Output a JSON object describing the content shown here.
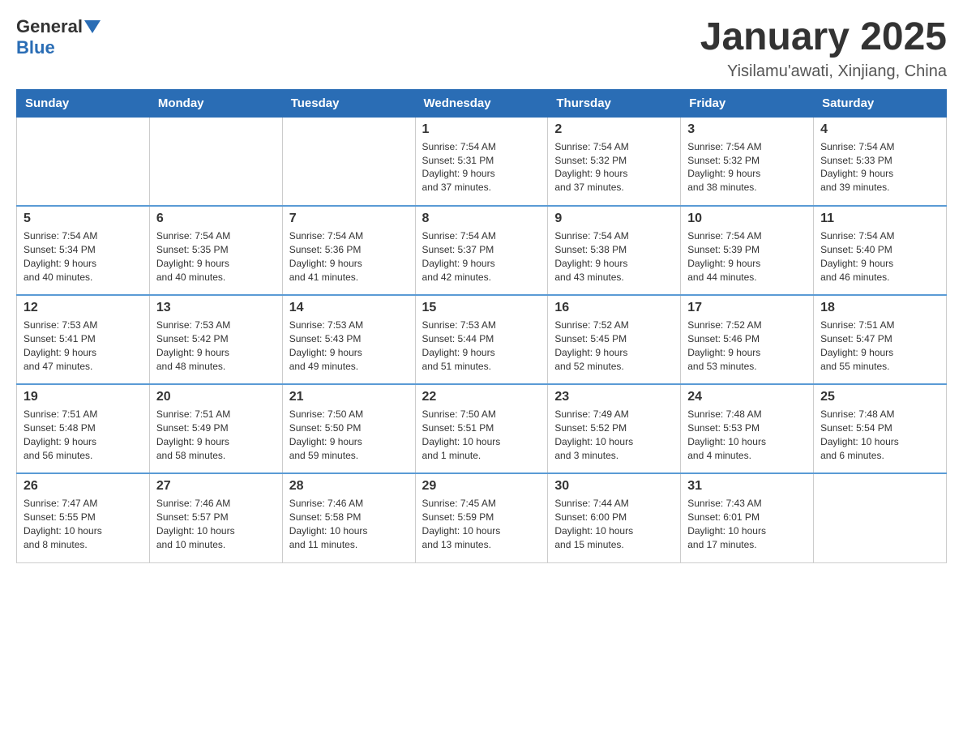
{
  "header": {
    "logo_general": "General",
    "logo_blue": "Blue",
    "month_title": "January 2025",
    "location": "Yisilamu'awati, Xinjiang, China"
  },
  "days_of_week": [
    "Sunday",
    "Monday",
    "Tuesday",
    "Wednesday",
    "Thursday",
    "Friday",
    "Saturday"
  ],
  "weeks": [
    [
      {
        "day": "",
        "info": ""
      },
      {
        "day": "",
        "info": ""
      },
      {
        "day": "",
        "info": ""
      },
      {
        "day": "1",
        "info": "Sunrise: 7:54 AM\nSunset: 5:31 PM\nDaylight: 9 hours\nand 37 minutes."
      },
      {
        "day": "2",
        "info": "Sunrise: 7:54 AM\nSunset: 5:32 PM\nDaylight: 9 hours\nand 37 minutes."
      },
      {
        "day": "3",
        "info": "Sunrise: 7:54 AM\nSunset: 5:32 PM\nDaylight: 9 hours\nand 38 minutes."
      },
      {
        "day": "4",
        "info": "Sunrise: 7:54 AM\nSunset: 5:33 PM\nDaylight: 9 hours\nand 39 minutes."
      }
    ],
    [
      {
        "day": "5",
        "info": "Sunrise: 7:54 AM\nSunset: 5:34 PM\nDaylight: 9 hours\nand 40 minutes."
      },
      {
        "day": "6",
        "info": "Sunrise: 7:54 AM\nSunset: 5:35 PM\nDaylight: 9 hours\nand 40 minutes."
      },
      {
        "day": "7",
        "info": "Sunrise: 7:54 AM\nSunset: 5:36 PM\nDaylight: 9 hours\nand 41 minutes."
      },
      {
        "day": "8",
        "info": "Sunrise: 7:54 AM\nSunset: 5:37 PM\nDaylight: 9 hours\nand 42 minutes."
      },
      {
        "day": "9",
        "info": "Sunrise: 7:54 AM\nSunset: 5:38 PM\nDaylight: 9 hours\nand 43 minutes."
      },
      {
        "day": "10",
        "info": "Sunrise: 7:54 AM\nSunset: 5:39 PM\nDaylight: 9 hours\nand 44 minutes."
      },
      {
        "day": "11",
        "info": "Sunrise: 7:54 AM\nSunset: 5:40 PM\nDaylight: 9 hours\nand 46 minutes."
      }
    ],
    [
      {
        "day": "12",
        "info": "Sunrise: 7:53 AM\nSunset: 5:41 PM\nDaylight: 9 hours\nand 47 minutes."
      },
      {
        "day": "13",
        "info": "Sunrise: 7:53 AM\nSunset: 5:42 PM\nDaylight: 9 hours\nand 48 minutes."
      },
      {
        "day": "14",
        "info": "Sunrise: 7:53 AM\nSunset: 5:43 PM\nDaylight: 9 hours\nand 49 minutes."
      },
      {
        "day": "15",
        "info": "Sunrise: 7:53 AM\nSunset: 5:44 PM\nDaylight: 9 hours\nand 51 minutes."
      },
      {
        "day": "16",
        "info": "Sunrise: 7:52 AM\nSunset: 5:45 PM\nDaylight: 9 hours\nand 52 minutes."
      },
      {
        "day": "17",
        "info": "Sunrise: 7:52 AM\nSunset: 5:46 PM\nDaylight: 9 hours\nand 53 minutes."
      },
      {
        "day": "18",
        "info": "Sunrise: 7:51 AM\nSunset: 5:47 PM\nDaylight: 9 hours\nand 55 minutes."
      }
    ],
    [
      {
        "day": "19",
        "info": "Sunrise: 7:51 AM\nSunset: 5:48 PM\nDaylight: 9 hours\nand 56 minutes."
      },
      {
        "day": "20",
        "info": "Sunrise: 7:51 AM\nSunset: 5:49 PM\nDaylight: 9 hours\nand 58 minutes."
      },
      {
        "day": "21",
        "info": "Sunrise: 7:50 AM\nSunset: 5:50 PM\nDaylight: 9 hours\nand 59 minutes."
      },
      {
        "day": "22",
        "info": "Sunrise: 7:50 AM\nSunset: 5:51 PM\nDaylight: 10 hours\nand 1 minute."
      },
      {
        "day": "23",
        "info": "Sunrise: 7:49 AM\nSunset: 5:52 PM\nDaylight: 10 hours\nand 3 minutes."
      },
      {
        "day": "24",
        "info": "Sunrise: 7:48 AM\nSunset: 5:53 PM\nDaylight: 10 hours\nand 4 minutes."
      },
      {
        "day": "25",
        "info": "Sunrise: 7:48 AM\nSunset: 5:54 PM\nDaylight: 10 hours\nand 6 minutes."
      }
    ],
    [
      {
        "day": "26",
        "info": "Sunrise: 7:47 AM\nSunset: 5:55 PM\nDaylight: 10 hours\nand 8 minutes."
      },
      {
        "day": "27",
        "info": "Sunrise: 7:46 AM\nSunset: 5:57 PM\nDaylight: 10 hours\nand 10 minutes."
      },
      {
        "day": "28",
        "info": "Sunrise: 7:46 AM\nSunset: 5:58 PM\nDaylight: 10 hours\nand 11 minutes."
      },
      {
        "day": "29",
        "info": "Sunrise: 7:45 AM\nSunset: 5:59 PM\nDaylight: 10 hours\nand 13 minutes."
      },
      {
        "day": "30",
        "info": "Sunrise: 7:44 AM\nSunset: 6:00 PM\nDaylight: 10 hours\nand 15 minutes."
      },
      {
        "day": "31",
        "info": "Sunrise: 7:43 AM\nSunset: 6:01 PM\nDaylight: 10 hours\nand 17 minutes."
      },
      {
        "day": "",
        "info": ""
      }
    ]
  ]
}
